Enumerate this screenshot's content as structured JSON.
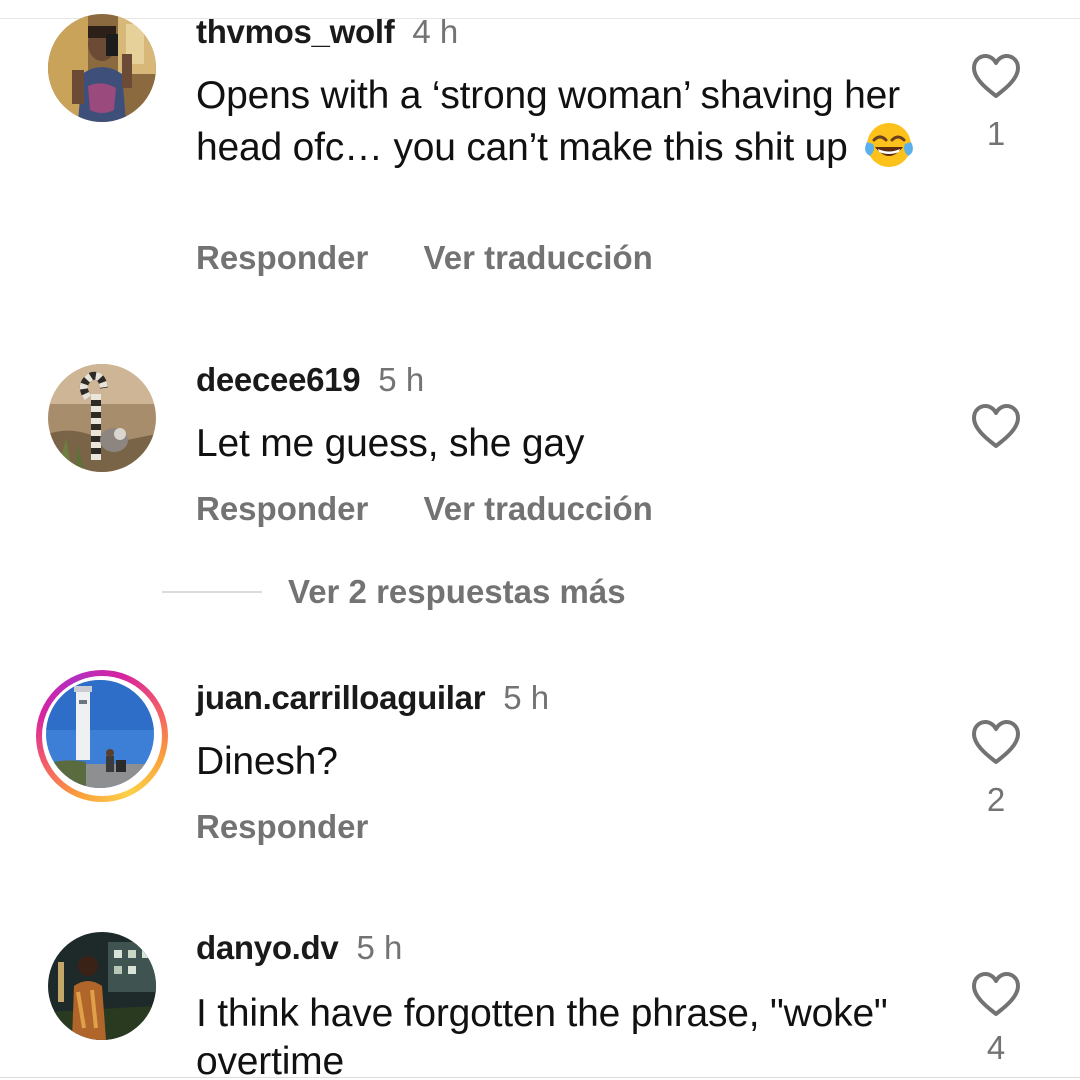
{
  "comments": [
    {
      "username": "thvmos_wolf",
      "time": "4 h",
      "text": "Opens with a ‘strong woman’ shaving her head ofc… you can’t make this shit up",
      "emoji": "😂",
      "actions": {
        "reply": "Responder",
        "translate": "Ver traducción"
      },
      "likes": "1",
      "avatar_icon": "user-photo-icon"
    },
    {
      "username": "deecee619",
      "time": "5 h",
      "text": "Let me guess, she gay",
      "actions": {
        "reply": "Responder",
        "translate": "Ver traducción"
      },
      "likes": "",
      "avatar_icon": "lemur-photo-icon"
    },
    {
      "username": "juan.carrilloaguilar",
      "time": "5 h",
      "text": "Dinesh?",
      "actions": {
        "reply": "Responder"
      },
      "likes": "2",
      "avatar_icon": "tower-photo-icon",
      "has_story_ring": true
    },
    {
      "username": "danyo.dv",
      "time": "5 h",
      "text": "I think have forgotten the phrase, \"woke\" overtime",
      "actions": {},
      "likes": "4",
      "avatar_icon": "night-photo-icon"
    }
  ],
  "replies_toggle": {
    "label": "Ver 2 respuestas más"
  },
  "icons": {
    "like": "heart-outline-icon"
  },
  "colors": {
    "text": "#111111",
    "secondary": "#737373",
    "divider": "#dcdcdc",
    "story_ring_start": "#f9a13a",
    "story_ring_end": "#d6249f"
  }
}
